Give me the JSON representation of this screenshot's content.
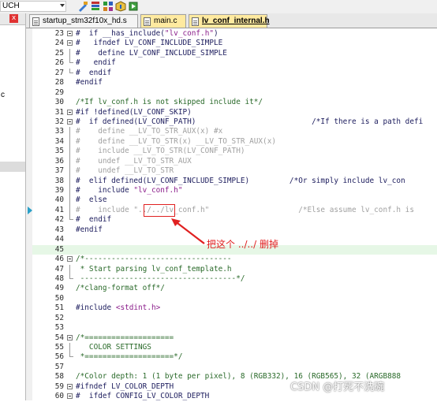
{
  "toolbar": {
    "combo_value": "UCH",
    "icons": [
      "build-target-icon",
      "options-icon",
      "manage-components-icon",
      "pack-installer-icon",
      "run-icon"
    ]
  },
  "left_panel": {
    "close_glyph": "x",
    "fragment_text": "c"
  },
  "tabs": [
    {
      "label": "startup_stm32f10x_hd.s",
      "active": false
    },
    {
      "label": "main.c",
      "active": false
    },
    {
      "label": "lv_conf_internal.h",
      "active": true
    }
  ],
  "colors": {
    "active_tab": "#ffeaa0",
    "highlight_line": "#e6f7e6",
    "annotation": "#e02020",
    "breakpoint_arrow": "#2aa0c8"
  },
  "code_lines": [
    {
      "num": "23",
      "text": "#  if __has_include(\"lv_conf.h\")",
      "style": "pp",
      "fold": "box"
    },
    {
      "num": "24",
      "text": "#   ifndef LV_CONF_INCLUDE_SIMPLE",
      "style": "pp",
      "fold": "box"
    },
    {
      "num": "25",
      "text": "#    define LV_CONF_INCLUDE_SIMPLE",
      "style": "pp",
      "fold": "line"
    },
    {
      "num": "26",
      "text": "#   endif",
      "style": "pp",
      "fold": "end"
    },
    {
      "num": "27",
      "text": "#  endif",
      "style": "pp",
      "fold": "end"
    },
    {
      "num": "28",
      "text": "#endif",
      "style": "pp",
      "fold": "none"
    },
    {
      "num": "29",
      "text": "",
      "style": "plain",
      "fold": "none"
    },
    {
      "num": "30",
      "text": "/*If lv_conf.h is not skipped include it*/",
      "style": "cm",
      "fold": "none"
    },
    {
      "num": "31",
      "text": "#if !defined(LV_CONF_SKIP)",
      "style": "pp",
      "fold": "box"
    },
    {
      "num": "32",
      "text": "#  if defined(LV_CONF_PATH)                          /*If there is a path defi",
      "style": "pp",
      "fold": "box"
    },
    {
      "num": "33",
      "text": "#    define __LV_TO_STR_AUX(x) #x",
      "style": "gray",
      "fold": "line"
    },
    {
      "num": "34",
      "text": "#    define __LV_TO_STR(x) __LV_TO_STR_AUX(x)",
      "style": "gray",
      "fold": "line"
    },
    {
      "num": "35",
      "text": "#    include __LV_TO_STR(LV_CONF_PATH)",
      "style": "gray",
      "fold": "line"
    },
    {
      "num": "36",
      "text": "#    undef __LV_TO_STR_AUX",
      "style": "gray",
      "fold": "line"
    },
    {
      "num": "37",
      "text": "#    undef __LV_TO_STR",
      "style": "gray",
      "fold": "line"
    },
    {
      "num": "38",
      "text": "#  elif defined(LV_CONF_INCLUDE_SIMPLE)         /*Or simply include lv_con",
      "style": "pp",
      "fold": "line"
    },
    {
      "num": "39",
      "text": "#    include \"lv_conf.h\"",
      "style": "pp",
      "fold": "line"
    },
    {
      "num": "40",
      "text": "#  else",
      "style": "pp",
      "fold": "line"
    },
    {
      "num": "41",
      "text": "#    include \"../../lv_conf.h\"                    /*Else assume lv_conf.h is",
      "style": "gray",
      "fold": "line"
    },
    {
      "num": "42",
      "text": "#  endif",
      "style": "pp",
      "fold": "end"
    },
    {
      "num": "43",
      "text": "#endif",
      "style": "pp",
      "fold": "none"
    },
    {
      "num": "44",
      "text": "",
      "style": "plain",
      "fold": "none"
    },
    {
      "num": "45",
      "text": "",
      "style": "plain",
      "fold": "none",
      "highlight": true
    },
    {
      "num": "46",
      "text": "/*---------------------------------",
      "style": "cm",
      "fold": "box"
    },
    {
      "num": "47",
      "text": " * Start parsing lv_conf_template.h",
      "style": "cm",
      "fold": "line"
    },
    {
      "num": "48",
      "text": " -----------------------------------*/",
      "style": "cm",
      "fold": "end"
    },
    {
      "num": "49",
      "text": "/*clang-format off*/",
      "style": "cm",
      "fold": "none"
    },
    {
      "num": "50",
      "text": "",
      "style": "plain",
      "fold": "none"
    },
    {
      "num": "51",
      "text": "#include <stdint.h>",
      "style": "pp",
      "fold": "none"
    },
    {
      "num": "52",
      "text": "",
      "style": "plain",
      "fold": "none"
    },
    {
      "num": "53",
      "text": "",
      "style": "plain",
      "fold": "none"
    },
    {
      "num": "54",
      "text": "/*====================",
      "style": "cm",
      "fold": "box"
    },
    {
      "num": "55",
      "text": "   COLOR SETTINGS",
      "style": "cm",
      "fold": "line"
    },
    {
      "num": "56",
      "text": " *====================*/",
      "style": "cm",
      "fold": "end"
    },
    {
      "num": "57",
      "text": "",
      "style": "plain",
      "fold": "none"
    },
    {
      "num": "58",
      "text": "/*Color depth: 1 (1 byte per pixel), 8 (RGB332), 16 (RGB565), 32 (ARGB888",
      "style": "cm",
      "fold": "none"
    },
    {
      "num": "59",
      "text": "#ifndef LV_COLOR_DEPTH",
      "style": "pp",
      "fold": "box"
    },
    {
      "num": "60",
      "text": "#  ifdef CONFIG_LV_COLOR_DEPTH",
      "style": "pp",
      "fold": "box"
    }
  ],
  "annotation": {
    "text": "把这个 ../../ 删掉"
  },
  "watermark": "CSDN @打死不洗碗"
}
